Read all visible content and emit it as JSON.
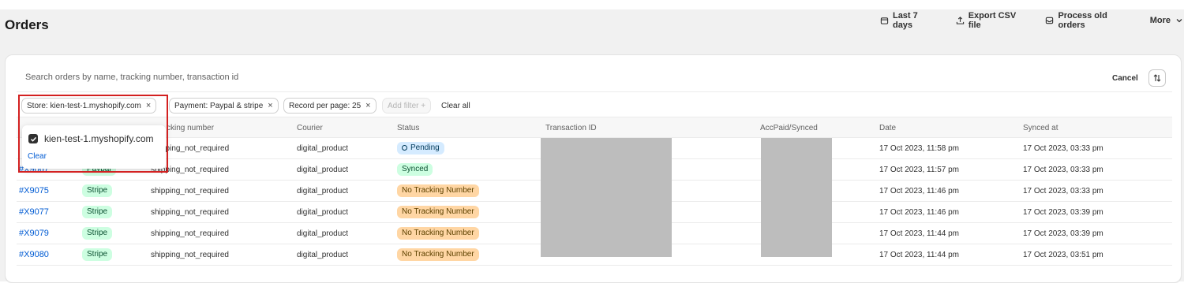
{
  "header": {
    "title": "Orders",
    "actions": {
      "last7": "Last 7 days",
      "export": "Export CSV file",
      "process": "Process old orders",
      "more": "More"
    }
  },
  "search": {
    "placeholder": "Search orders by name, tracking number, transaction id"
  },
  "toolbar": {
    "cancel": "Cancel"
  },
  "filters": {
    "store": "Store: kien-test-1.myshopify.com",
    "payment": "Payment: Paypal & stripe",
    "record": "Record per page: 25",
    "add": "Add filter +",
    "clear_all": "Clear all"
  },
  "popover": {
    "option": "kien-test-1.myshopify.com",
    "checked": true,
    "clear": "Clear"
  },
  "table": {
    "columns": [
      "cking number",
      "Courier",
      "Status",
      "Transaction ID",
      "AccPaid/Synced",
      "Date",
      "Synced at"
    ],
    "rows": [
      {
        "order": "",
        "payment": "",
        "tracking": "pping_not_required",
        "courier": "digital_product",
        "status": "Pending",
        "date": "17 Oct 2023, 11:58 pm",
        "synced": "17 Oct 2023, 03:33 pm"
      },
      {
        "order": "#X9067",
        "payment": "Paypal",
        "tracking": "shipping_not_required",
        "courier": "digital_product",
        "status": "Synced",
        "date": "17 Oct 2023, 11:57 pm",
        "synced": "17 Oct 2023, 03:33 pm"
      },
      {
        "order": "#X9075",
        "payment": "Stripe",
        "tracking": "shipping_not_required",
        "courier": "digital_product",
        "status": "No Tracking Number",
        "date": "17 Oct 2023, 11:46 pm",
        "synced": "17 Oct 2023, 03:33 pm"
      },
      {
        "order": "#X9077",
        "payment": "Stripe",
        "tracking": "shipping_not_required",
        "courier": "digital_product",
        "status": "No Tracking Number",
        "date": "17 Oct 2023, 11:46 pm",
        "synced": "17 Oct 2023, 03:39 pm"
      },
      {
        "order": "#X9079",
        "payment": "Stripe",
        "tracking": "shipping_not_required",
        "courier": "digital_product",
        "status": "No Tracking Number",
        "date": "17 Oct 2023, 11:44 pm",
        "synced": "17 Oct 2023, 03:39 pm"
      },
      {
        "order": "#X9080",
        "payment": "Stripe",
        "tracking": "shipping_not_required",
        "courier": "digital_product",
        "status": "No Tracking Number",
        "date": "17 Oct 2023, 11:44 pm",
        "synced": "17 Oct 2023, 03:51 pm"
      }
    ]
  },
  "colors": {
    "accent_link": "#005bd3",
    "badge_green": "#cdfee1",
    "badge_blue": "#d5ebff",
    "badge_orange": "#ffd6a4",
    "highlight_box": "#d32020",
    "redaction": "#bdbdbd"
  },
  "icons": [
    "calendar-icon",
    "export-icon",
    "inbox-icon",
    "chevron-down-icon",
    "sort-icon",
    "close-icon",
    "checkbox-checked-icon"
  ]
}
